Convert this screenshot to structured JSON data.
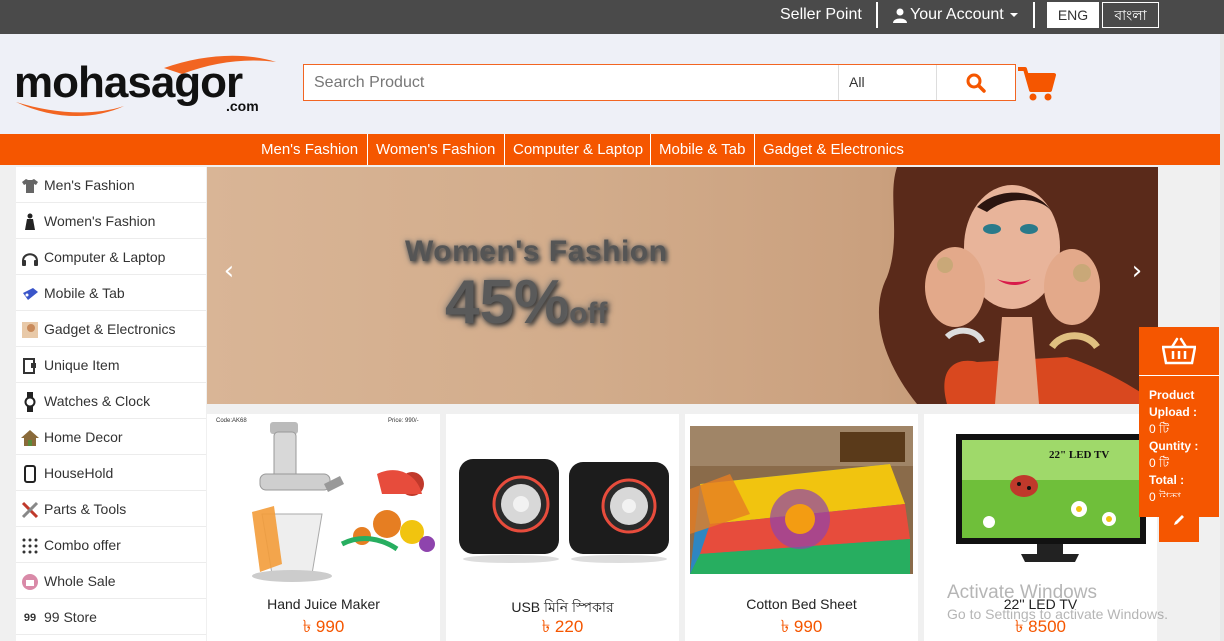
{
  "topbar": {
    "seller_point": "Seller Point",
    "account": "Your Account",
    "lang_eng": "ENG",
    "lang_bn": "বাংলা"
  },
  "logo": {
    "name": "mohasagor",
    "domain": ".com"
  },
  "search": {
    "placeholder": "Search Product",
    "category": "All"
  },
  "category_nav": [
    "Men's Fashion",
    "Women's Fashion",
    "Computer & Laptop",
    "Mobile & Tab",
    "Gadget & Electronics"
  ],
  "sidebar": [
    {
      "label": "Men's Fashion",
      "icon": "shirt-icon"
    },
    {
      "label": "Women's Fashion",
      "icon": "dress-icon"
    },
    {
      "label": "Computer & Laptop",
      "icon": "headphones-icon"
    },
    {
      "label": "Mobile & Tab",
      "icon": "gamepad-icon"
    },
    {
      "label": "Gadget & Electronics",
      "icon": "gadget-icon"
    },
    {
      "label": "Unique Item",
      "icon": "unique-item-icon"
    },
    {
      "label": "Watches & Clock",
      "icon": "watch-icon"
    },
    {
      "label": "Home Decor",
      "icon": "house-icon"
    },
    {
      "label": "HouseHold",
      "icon": "phone-icon"
    },
    {
      "label": "Parts & Tools",
      "icon": "tools-icon"
    },
    {
      "label": "Combo offer",
      "icon": "combo-icon"
    },
    {
      "label": "Whole Sale",
      "icon": "wholesale-icon"
    },
    {
      "label": "99 Store",
      "icon": "99-store-icon",
      "glyph": "99"
    }
  ],
  "banner": {
    "title": "Women's Fashion",
    "discount": "45%",
    "discount_suffix": "off"
  },
  "products": [
    {
      "name": "Hand Juice Maker",
      "price": "৳ 990",
      "img_code": "Code:AK68",
      "img_price": "Price: 990/-"
    },
    {
      "name": "USB মিনি স্পিকার",
      "price": "৳ 220"
    },
    {
      "name": "Cotton Bed Sheet",
      "price": "৳ 990"
    },
    {
      "name": "22'' LED TV",
      "price": "৳ 8500",
      "img_label": "22\" LED TV"
    }
  ],
  "mini_cart": {
    "upload_label": "Product Upload :",
    "upload_value": "0 টি",
    "quantity_label": "Quntity :",
    "quantity_value": "0 টি",
    "total_label": "Total :",
    "total_value": "0 টাকা"
  },
  "watermark": {
    "line1": "Activate Windows",
    "line2": "Go to Settings to activate Windows."
  },
  "colors": {
    "accent": "#f55600",
    "topbar": "#4a4a4a",
    "header_bg": "#eef0f7"
  }
}
